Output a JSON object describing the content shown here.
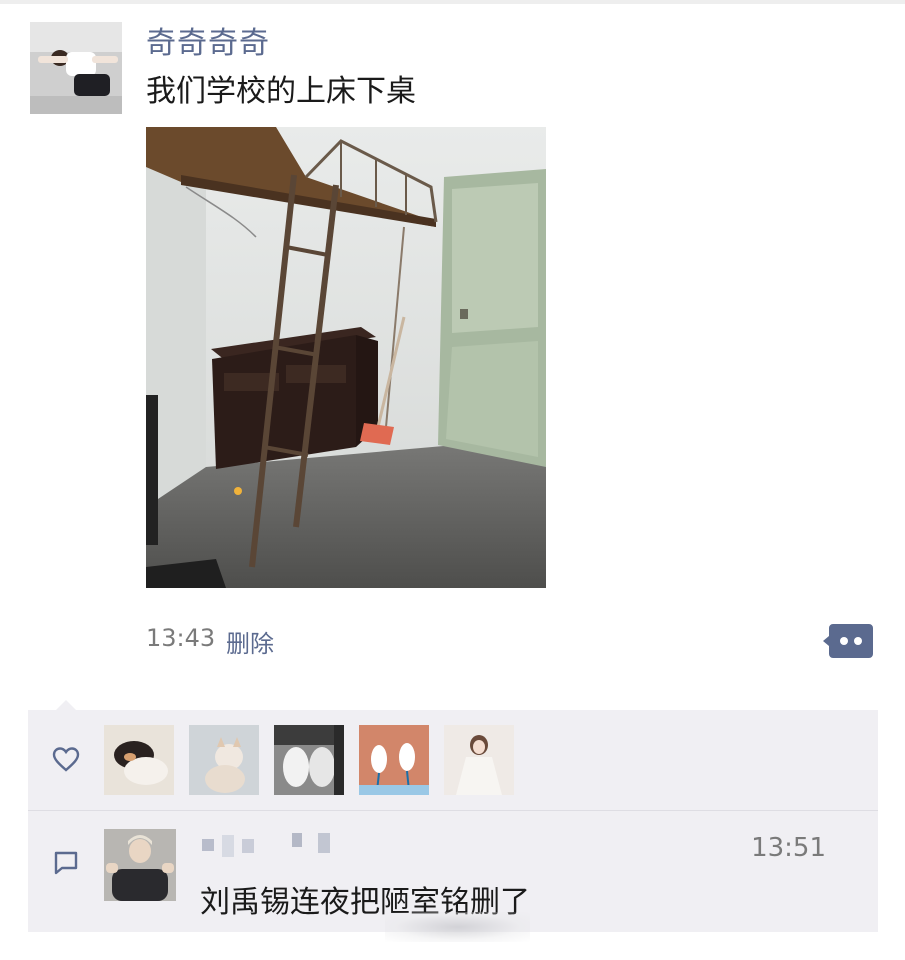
{
  "post": {
    "username": "奇奇奇奇",
    "text": "我们学校的上床下桌",
    "time": "13:43",
    "delete_label": "删除"
  },
  "likes": {
    "icon": "heart-icon",
    "avatar_count": 5
  },
  "comment": {
    "icon": "comment-icon",
    "time": "13:51",
    "text": "刘禹锡连夜把陋室铭删了"
  },
  "colors": {
    "name_blue": "#5b6a8f",
    "panel_bg": "#f0eff3",
    "meta_gray": "#7a7a7a"
  }
}
